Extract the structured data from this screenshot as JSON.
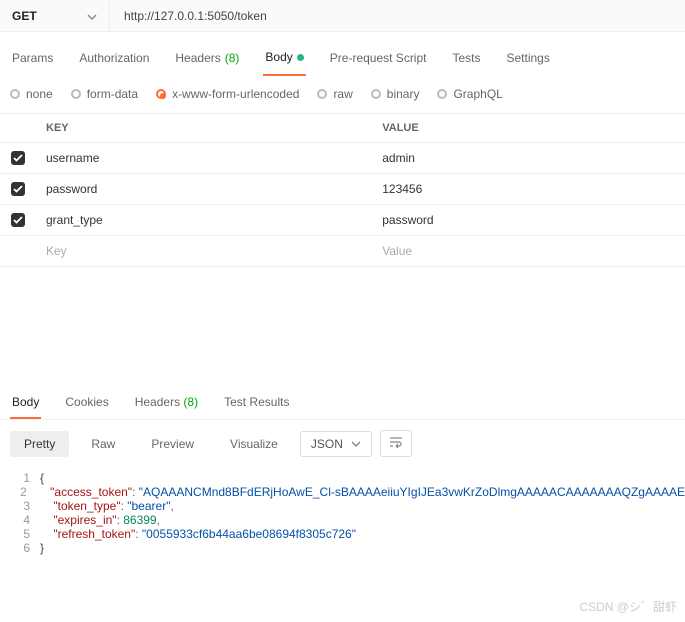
{
  "request": {
    "method": "GET",
    "url": "http://127.0.0.1:5050/token"
  },
  "tabs": {
    "params": "Params",
    "auth": "Authorization",
    "headers_label": "Headers",
    "headers_count": "(8)",
    "body": "Body",
    "prereq": "Pre-request Script",
    "tests": "Tests",
    "settings": "Settings"
  },
  "bodytype": {
    "none": "none",
    "formdata": "form-data",
    "xform": "x-www-form-urlencoded",
    "raw": "raw",
    "binary": "binary",
    "graphql": "GraphQL"
  },
  "table": {
    "headers": {
      "key": "KEY",
      "value": "VALUE"
    },
    "rows": [
      {
        "key": "username",
        "value": "admin"
      },
      {
        "key": "password",
        "value": "123456"
      },
      {
        "key": "grant_type",
        "value": "password"
      }
    ],
    "placeholder": {
      "key": "Key",
      "value": "Value"
    }
  },
  "response": {
    "tabs": {
      "body": "Body",
      "cookies": "Cookies",
      "headers_label": "Headers",
      "headers_count": "(8)",
      "test_results": "Test Results"
    },
    "views": {
      "pretty": "Pretty",
      "raw": "Raw",
      "preview": "Preview",
      "visualize": "Visualize"
    },
    "format": "JSON",
    "json_lines": [
      {
        "t": "brace",
        "v": "{"
      },
      {
        "t": "kv",
        "k": "\"access_token\"",
        "sep": ": ",
        "v": "\"AQAAANCMnd8BFdERjHoAwE_Cl-sBAAAAeiiuYIgIJEa3vwKrZoDlmgAAAAACAAAAAAAQZgAAAAE",
        "comma": ""
      },
      {
        "t": "kv",
        "k": "\"token_type\"",
        "sep": ": ",
        "v": "\"bearer\"",
        "comma": ","
      },
      {
        "t": "kvn",
        "k": "\"expires_in\"",
        "sep": ": ",
        "v": "86399",
        "comma": ","
      },
      {
        "t": "kv",
        "k": "\"refresh_token\"",
        "sep": ": ",
        "v": "\"0055933cf6b44aa6be08694f8305c726\"",
        "comma": ""
      },
      {
        "t": "brace",
        "v": "}"
      }
    ]
  },
  "watermark": "CSDN @シ゛甜虾"
}
